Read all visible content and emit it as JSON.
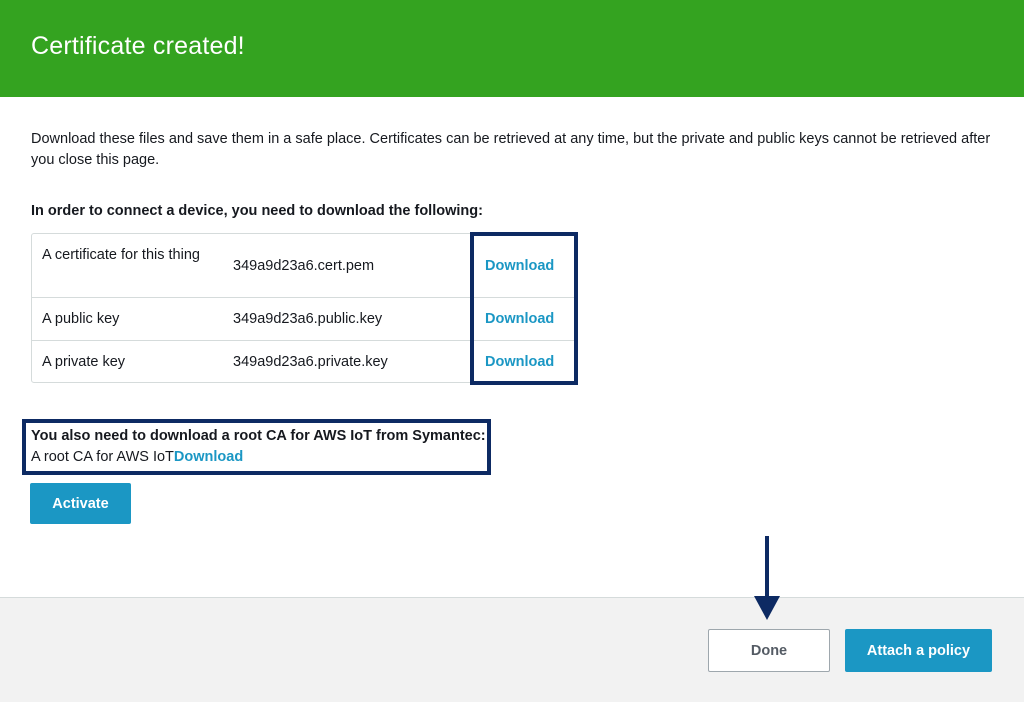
{
  "header": {
    "title": "Certificate created!",
    "color": "#34a320"
  },
  "intro": {
    "text": "Download these files and save them in a safe place. Certificates can be retrieved at any time, but the private and public keys cannot be retrieved after you close this page."
  },
  "downloads": {
    "heading": "In order to connect a device, you need to download the following:",
    "rows": [
      {
        "label": "A certificate for this thing",
        "file": "349a9d23a6.cert.pem",
        "link": "Download"
      },
      {
        "label": "A public key",
        "file": "349a9d23a6.public.key",
        "link": "Download"
      },
      {
        "label": "A private key",
        "file": "349a9d23a6.private.key",
        "link": "Download"
      }
    ]
  },
  "root_ca": {
    "heading": "You also need to download a root CA for AWS IoT from Symantec:",
    "label": "A root CA for AWS IoT",
    "link": "Download"
  },
  "actions": {
    "activate": "Activate",
    "done": "Done",
    "attach_policy": "Attach a policy"
  },
  "colors": {
    "accent": "#1b97c4",
    "highlight": "#0d2a63"
  },
  "annotations": {
    "arrow_icon": "arrow-down-icon"
  }
}
